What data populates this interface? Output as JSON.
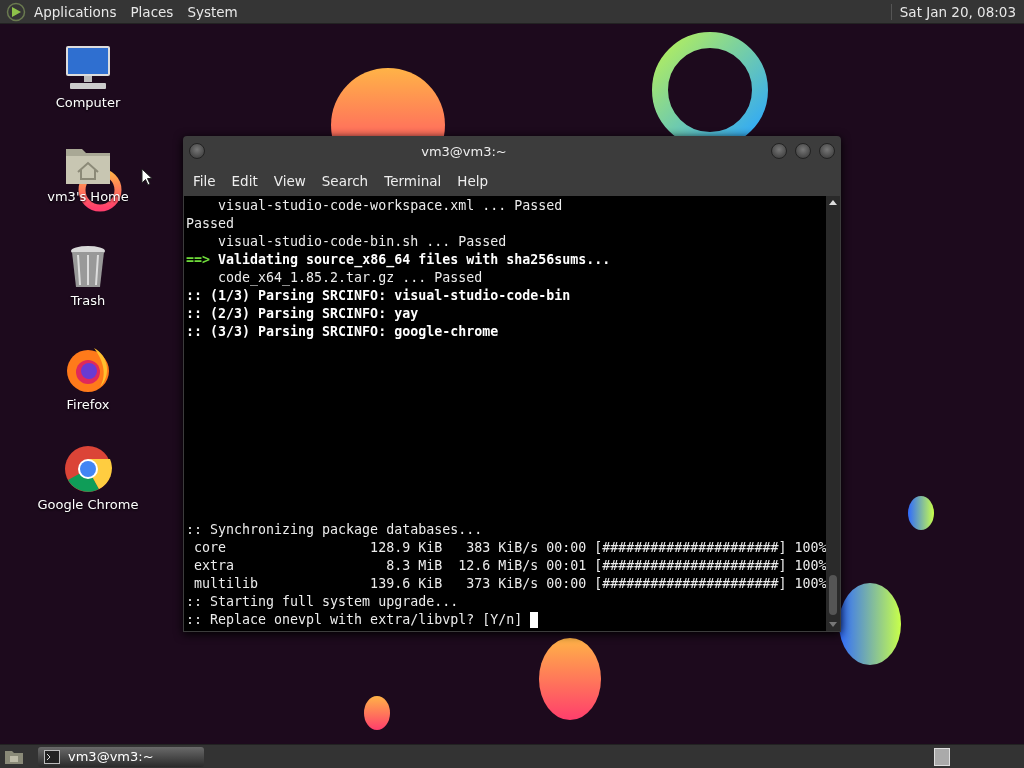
{
  "top_panel": {
    "menus": [
      "Applications",
      "Places",
      "System"
    ],
    "clock": "Sat Jan 20, 08:03"
  },
  "desktop_icons": [
    {
      "label": "Computer",
      "kind": "computer"
    },
    {
      "label": "vm3's Home",
      "kind": "home"
    },
    {
      "label": "Trash",
      "kind": "trash"
    },
    {
      "label": "Firefox",
      "kind": "firefox"
    },
    {
      "label": "Google Chrome",
      "kind": "chrome"
    }
  ],
  "terminal": {
    "title": "vm3@vm3:~",
    "menu": [
      "File",
      "Edit",
      "View",
      "Search",
      "Terminal",
      "Help"
    ],
    "upper_lines": [
      [
        {
          "text": "    visual-studio-code-workspace.xml ... Passed",
          "kind": "plain"
        }
      ],
      [
        {
          "text": "Passed",
          "kind": "plain"
        }
      ],
      [
        {
          "text": "    visual-studio-code-bin.sh ... Passed",
          "kind": "plain"
        }
      ],
      [
        {
          "text": "==>",
          "kind": "arrow"
        },
        {
          "text": " Validating source_x86_64 files with sha256sums...",
          "kind": "bold"
        }
      ],
      [
        {
          "text": "    code_x64_1.85.2.tar.gz ... Passed",
          "kind": "plain"
        }
      ],
      [
        {
          "text": ":: (1/3) Parsing SRCINFO: visual-studio-code-bin",
          "kind": "bold"
        }
      ],
      [
        {
          "text": ":: (2/3) Parsing SRCINFO: yay",
          "kind": "bold"
        }
      ],
      [
        {
          "text": ":: (3/3) Parsing SRCINFO: google-chrome",
          "kind": "bold"
        }
      ]
    ],
    "lower_lines": [
      [
        {
          "text": ":: Synchronizing package databases...",
          "kind": "plain"
        }
      ],
      [
        {
          "text": " core                  128.9 KiB   383 KiB/s 00:00 [######################] 100%",
          "kind": "plain"
        }
      ],
      [
        {
          "text": " extra                   8.3 MiB  12.6 MiB/s 00:01 [######################] 100%",
          "kind": "plain"
        }
      ],
      [
        {
          "text": " multilib              139.6 KiB   373 KiB/s 00:00 [######################] 100%",
          "kind": "plain"
        }
      ],
      [
        {
          "text": ":: Starting full system upgrade...",
          "kind": "plain"
        }
      ],
      [
        {
          "text": ":: Replace onevpl with extra/libvpl? [Y/n] ",
          "kind": "plain"
        }
      ]
    ],
    "cursor": true
  },
  "taskbar": {
    "tasks": [
      {
        "label": "vm3@vm3:~",
        "selected": true
      }
    ]
  }
}
